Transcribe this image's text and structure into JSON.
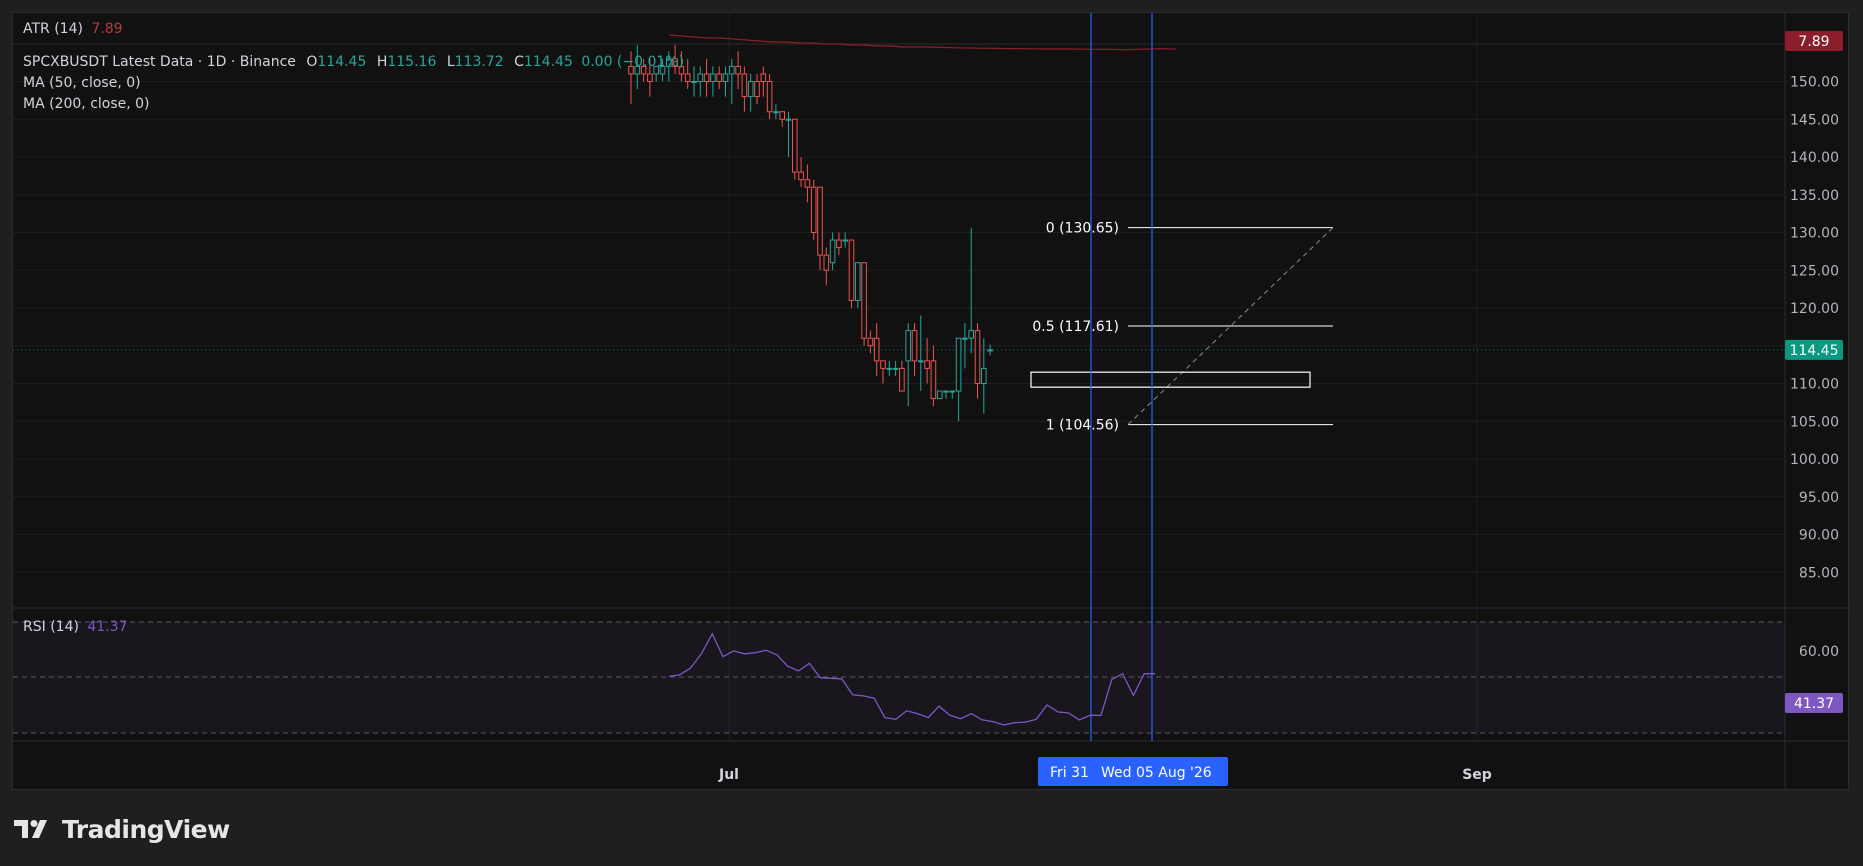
{
  "brand": {
    "name": "TradingView",
    "logo_icon": "tradingview-logo-icon"
  },
  "atr": {
    "label": "ATR (14)",
    "value": "7.89",
    "badge": "7.89",
    "badge_color": "#8b1e2a"
  },
  "symbol": {
    "title": "SPCXBUSDT Latest Data · 1D · Binance",
    "o_label": "O",
    "o": "114.45",
    "h_label": "H",
    "h": "115.16",
    "l_label": "L",
    "l": "113.72",
    "c_label": "C",
    "c": "114.45",
    "change": "0.00 (−0.01%)"
  },
  "indicators": {
    "ma50": "MA (50, close, 0)",
    "ma200": "MA (200, close, 0)"
  },
  "rsi": {
    "label": "RSI (14)",
    "value": "41.37",
    "badge": "41.37",
    "badge_color": "#7e57c2",
    "tick": "60.00"
  },
  "price_badge": {
    "value": "114.45",
    "color": "#089981"
  },
  "time_axis": {
    "labels": [
      "Jul",
      "Sep"
    ],
    "highlight_left": "Fri 31",
    "highlight_right": "Wed 05 Aug '26",
    "highlight_color": "#2962ff"
  },
  "colors": {
    "up": "#26a69a",
    "down": "#ef5350",
    "background": "#111111",
    "rsi_line": "#7e57c2",
    "atr_line": "#8b1e2a"
  },
  "chart_data": {
    "type": "candlestick",
    "title": "SPCXBUSDT Latest Data · 1D · Binance",
    "price_axis": {
      "ticks": [
        150,
        145,
        140,
        135,
        130,
        125,
        120,
        115,
        110,
        105,
        100,
        95,
        90,
        85
      ]
    },
    "last_price": 114.45,
    "candles": [
      {
        "o": 152,
        "h": 154,
        "l": 147,
        "c": 151
      },
      {
        "o": 151,
        "h": 155,
        "l": 149,
        "c": 152
      },
      {
        "o": 152,
        "h": 153,
        "l": 150,
        "c": 151
      },
      {
        "o": 151,
        "h": 153,
        "l": 148,
        "c": 150
      },
      {
        "o": 151,
        "h": 152,
        "l": 150,
        "c": 152
      },
      {
        "o": 151,
        "h": 153,
        "l": 150,
        "c": 152
      },
      {
        "o": 152,
        "h": 154,
        "l": 150,
        "c": 153
      },
      {
        "o": 153,
        "h": 156,
        "l": 151,
        "c": 152
      },
      {
        "o": 152,
        "h": 154,
        "l": 150,
        "c": 151
      },
      {
        "o": 151,
        "h": 153,
        "l": 149,
        "c": 150
      },
      {
        "o": 150,
        "h": 152,
        "l": 148,
        "c": 150
      },
      {
        "o": 150,
        "h": 152,
        "l": 148,
        "c": 151
      },
      {
        "o": 151,
        "h": 153,
        "l": 148,
        "c": 150
      },
      {
        "o": 150,
        "h": 152,
        "l": 148,
        "c": 151
      },
      {
        "o": 151,
        "h": 152,
        "l": 149,
        "c": 150
      },
      {
        "o": 150,
        "h": 152,
        "l": 148,
        "c": 151
      },
      {
        "o": 151,
        "h": 153,
        "l": 147,
        "c": 152
      },
      {
        "o": 152,
        "h": 154,
        "l": 149,
        "c": 151
      },
      {
        "o": 151,
        "h": 152,
        "l": 146,
        "c": 148
      },
      {
        "o": 148,
        "h": 151,
        "l": 146,
        "c": 150
      },
      {
        "o": 150,
        "h": 151,
        "l": 147,
        "c": 148
      },
      {
        "o": 151,
        "h": 152,
        "l": 148,
        "c": 150
      },
      {
        "o": 150,
        "h": 151,
        "l": 145,
        "c": 146
      },
      {
        "o": 146,
        "h": 147,
        "l": 145,
        "c": 146
      },
      {
        "o": 146,
        "h": 146,
        "l": 144,
        "c": 145
      },
      {
        "o": 145,
        "h": 146,
        "l": 140,
        "c": 145
      },
      {
        "o": 145,
        "h": 145,
        "l": 137,
        "c": 138
      },
      {
        "o": 138,
        "h": 140,
        "l": 136,
        "c": 137
      },
      {
        "o": 137,
        "h": 139,
        "l": 134,
        "c": 136
      },
      {
        "o": 136,
        "h": 137,
        "l": 129,
        "c": 130
      },
      {
        "o": 136,
        "h": 136,
        "l": 125,
        "c": 127
      },
      {
        "o": 127,
        "h": 128,
        "l": 123,
        "c": 125
      },
      {
        "o": 126,
        "h": 130,
        "l": 125,
        "c": 129
      },
      {
        "o": 129,
        "h": 130,
        "l": 127,
        "c": 128
      },
      {
        "o": 129,
        "h": 130,
        "l": 128,
        "c": 129
      },
      {
        "o": 129,
        "h": 129,
        "l": 120,
        "c": 121
      },
      {
        "o": 121,
        "h": 126,
        "l": 120,
        "c": 126
      },
      {
        "o": 126,
        "h": 126,
        "l": 115,
        "c": 116
      },
      {
        "o": 116,
        "h": 117,
        "l": 114,
        "c": 115
      },
      {
        "o": 116,
        "h": 118,
        "l": 111,
        "c": 113
      },
      {
        "o": 113,
        "h": 113,
        "l": 110,
        "c": 112
      },
      {
        "o": 112,
        "h": 113,
        "l": 111,
        "c": 112
      },
      {
        "o": 112,
        "h": 113,
        "l": 111,
        "c": 112
      },
      {
        "o": 112,
        "h": 113,
        "l": 109,
        "c": 109
      },
      {
        "o": 113,
        "h": 118,
        "l": 107,
        "c": 117
      },
      {
        "o": 117,
        "h": 118,
        "l": 111,
        "c": 113
      },
      {
        "o": 113,
        "h": 119,
        "l": 109,
        "c": 113
      },
      {
        "o": 113,
        "h": 116,
        "l": 110,
        "c": 112
      },
      {
        "o": 113,
        "h": 115,
        "l": 107,
        "c": 108
      },
      {
        "o": 108,
        "h": 109,
        "l": 108,
        "c": 109
      },
      {
        "o": 109,
        "h": 109,
        "l": 108,
        "c": 109
      },
      {
        "o": 109,
        "h": 109,
        "l": 108,
        "c": 109
      },
      {
        "o": 109,
        "h": 116,
        "l": 105,
        "c": 116
      },
      {
        "o": 116,
        "h": 118,
        "l": 112,
        "c": 116
      },
      {
        "o": 116,
        "h": 130.65,
        "l": 114,
        "c": 117
      },
      {
        "o": 117,
        "h": 118,
        "l": 108,
        "c": 110
      },
      {
        "o": 110,
        "h": 116,
        "l": 106,
        "c": 112
      },
      {
        "o": 114.45,
        "h": 115.16,
        "l": 113.72,
        "c": 114.45
      }
    ],
    "fibonacci": [
      {
        "level": "0",
        "price": 130.65,
        "label": "0 (130.65)"
      },
      {
        "level": "0.5",
        "price": 117.61,
        "label": "0.5 (117.61)"
      },
      {
        "level": "1",
        "price": 104.56,
        "label": "1 (104.56)"
      }
    ],
    "atr_series": [
      8.6,
      8.55,
      8.5,
      8.45,
      8.45,
      8.4,
      8.35,
      8.3,
      8.25,
      8.25,
      8.2,
      8.2,
      8.15,
      8.15,
      8.1,
      8.1,
      8.05,
      8.05,
      8.0,
      8.0,
      8.0,
      7.98,
      7.96,
      7.95,
      7.94,
      7.93,
      7.92,
      7.92,
      7.91,
      7.9,
      7.9,
      7.9,
      7.89,
      7.88,
      7.88,
      7.87,
      7.88,
      7.9,
      7.92,
      7.89
    ],
    "rsi_series": [
      46,
      46.3,
      47.5,
      50,
      53.5,
      49.5,
      50.5,
      50,
      50.2,
      50.6,
      49.8,
      47.8,
      47,
      48.3,
      45.8,
      45.7,
      45.6,
      42.8,
      42.6,
      42.2,
      38.8,
      38.5,
      40,
      39.5,
      38.8,
      40.8,
      39.2,
      38.6,
      39.5,
      38.4,
      38.1,
      37.5,
      37.9,
      38,
      38.5,
      41,
      39.8,
      39.6,
      38.4,
      39.2,
      39.2,
      45.5,
      46.5,
      42.7,
      46.5,
      46.5
    ]
  }
}
